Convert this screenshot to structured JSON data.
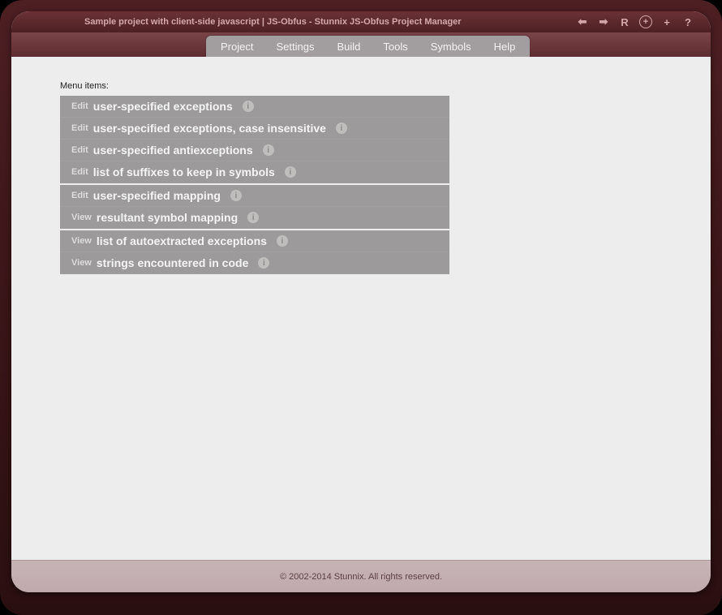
{
  "window": {
    "title": "Sample project with client-side javascript | JS-Obfus - Stunnix JS-Obfus Project Manager"
  },
  "toolbar": {
    "back": "⬅",
    "forward": "➡",
    "reload": "R",
    "zoom": "+",
    "add": "+",
    "help": "?"
  },
  "menu": {
    "items": [
      "Project",
      "Settings",
      "Build",
      "Tools",
      "Symbols",
      "Help"
    ]
  },
  "content": {
    "heading": "Menu items:",
    "groups": [
      [
        {
          "prefix": "Edit",
          "label": "user-specified exceptions"
        },
        {
          "prefix": "Edit",
          "label": "user-specified exceptions, case insensitive"
        },
        {
          "prefix": "Edit",
          "label": "user-specified antiexceptions"
        },
        {
          "prefix": "Edit",
          "label": "list of suffixes to keep in symbols"
        }
      ],
      [
        {
          "prefix": "Edit",
          "label": "user-specified mapping"
        },
        {
          "prefix": "View",
          "label": "resultant symbol mapping"
        }
      ],
      [
        {
          "prefix": "View",
          "label": "list of autoextracted exceptions"
        },
        {
          "prefix": "View",
          "label": "strings encountered in code"
        }
      ]
    ]
  },
  "footer": {
    "text": "© 2002-2014 Stunnix. All rights reserved."
  }
}
